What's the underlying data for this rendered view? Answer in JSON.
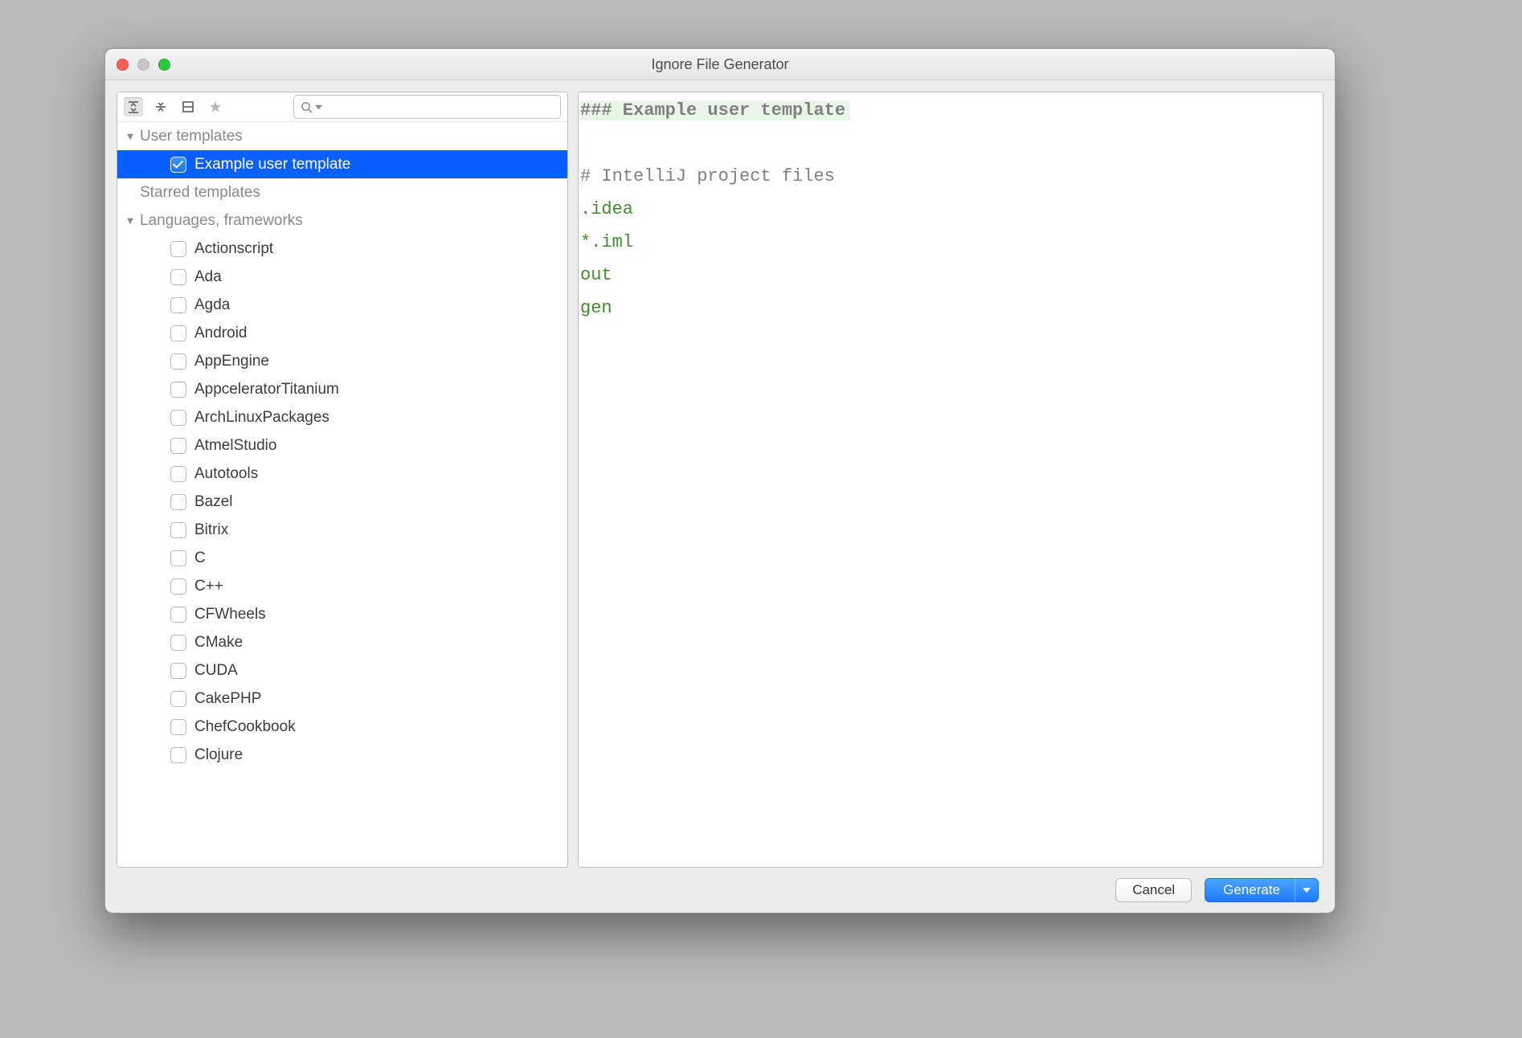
{
  "window": {
    "title": "Ignore File Generator"
  },
  "toolbar": {
    "search_placeholder": ""
  },
  "tree": {
    "groups": [
      {
        "label": "User templates",
        "expanded": true,
        "items": [
          {
            "label": "Example user template",
            "checked": true,
            "selected": true
          }
        ]
      },
      {
        "label": "Starred templates",
        "expanded": false,
        "items": []
      },
      {
        "label": "Languages, frameworks",
        "expanded": true,
        "items": [
          {
            "label": "Actionscript",
            "checked": false
          },
          {
            "label": "Ada",
            "checked": false
          },
          {
            "label": "Agda",
            "checked": false
          },
          {
            "label": "Android",
            "checked": false
          },
          {
            "label": "AppEngine",
            "checked": false
          },
          {
            "label": "AppceleratorTitanium",
            "checked": false
          },
          {
            "label": "ArchLinuxPackages",
            "checked": false
          },
          {
            "label": "AtmelStudio",
            "checked": false
          },
          {
            "label": "Autotools",
            "checked": false
          },
          {
            "label": "Bazel",
            "checked": false
          },
          {
            "label": "Bitrix",
            "checked": false
          },
          {
            "label": "C",
            "checked": false
          },
          {
            "label": "C++",
            "checked": false
          },
          {
            "label": "CFWheels",
            "checked": false
          },
          {
            "label": "CMake",
            "checked": false
          },
          {
            "label": "CUDA",
            "checked": false
          },
          {
            "label": "CakePHP",
            "checked": false
          },
          {
            "label": "ChefCookbook",
            "checked": false
          },
          {
            "label": "Clojure",
            "checked": false
          }
        ]
      }
    ]
  },
  "preview": {
    "lines": [
      {
        "kind": "header",
        "text": "### Example user template"
      },
      {
        "kind": "blank",
        "text": ""
      },
      {
        "kind": "comment",
        "text": "# IntelliJ project files"
      },
      {
        "kind": "pattern",
        "text": ".idea"
      },
      {
        "kind": "pattern",
        "text": "*.iml"
      },
      {
        "kind": "pattern",
        "text": "out"
      },
      {
        "kind": "pattern",
        "text": "gen"
      }
    ]
  },
  "footer": {
    "cancel_label": "Cancel",
    "generate_label": "Generate"
  }
}
